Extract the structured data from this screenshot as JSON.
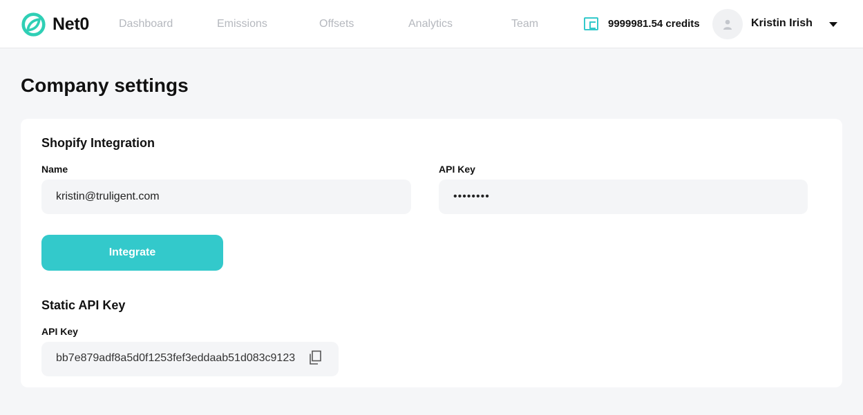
{
  "brand": {
    "name": "Net0",
    "accent": "#33c9cb"
  },
  "nav": {
    "items": [
      {
        "label": "Dashboard"
      },
      {
        "label": "Emissions"
      },
      {
        "label": "Offsets"
      },
      {
        "label": "Analytics"
      },
      {
        "label": "Team"
      }
    ]
  },
  "account": {
    "credits": "9999981.54 credits",
    "user_name": "Kristin Irish",
    "icons": {
      "wallet": "wallet-icon",
      "avatar": "user-avatar-icon",
      "menu": "chevron-down-icon"
    }
  },
  "page": {
    "title": "Company settings"
  },
  "shopify": {
    "title": "Shopify Integration",
    "name_label": "Name",
    "name_value": "kristin@truligent.com",
    "api_key_label": "API Key",
    "api_key_value": "••••••••",
    "integrate_label": "Integrate"
  },
  "static_api": {
    "title": "Static API Key",
    "label": "API Key",
    "value": "bb7e879adf8a5d0f1253fef3eddaab51d083c9123",
    "copy_icon": "copy-icon"
  }
}
